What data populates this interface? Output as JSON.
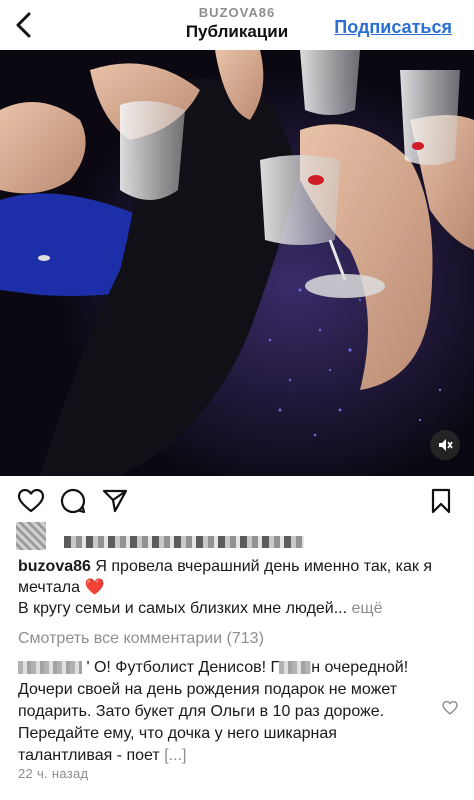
{
  "header": {
    "username": "BUZOVA86",
    "title": "Публикации",
    "subscribe_label": "Подписаться"
  },
  "icons": {
    "back": "chevron-left-icon",
    "sound": "sound-off-icon",
    "like": "heart-icon",
    "comment": "comment-icon",
    "share": "send-icon",
    "save": "bookmark-icon",
    "comment_like": "heart-outline-icon"
  },
  "caption": {
    "author": "buzova86",
    "text_line1": "Я провела вчерашний день именно так, как я мечтала",
    "emoji": "❤️",
    "text_line2": "В кругу семьи и самых близких мне людей...",
    "more_label": "ещё"
  },
  "view_all_comments": "Смотреть все комментарии (713)",
  "comment": {
    "start": "' О! Футболист Денисов! Г",
    "mid": "н очередной! Дочери своей на день рождения подарок не может подарить. Зато букет для Ольги в 10 раз дороже. Передайте ему, что дочка у него шикарная талантливая - поет",
    "ellipsis": "[...]"
  },
  "timestamp": "22 ч. назад",
  "colors": {
    "link": "#2a6fd1",
    "muted": "#8e8e8e",
    "heart": "#e0245e"
  }
}
